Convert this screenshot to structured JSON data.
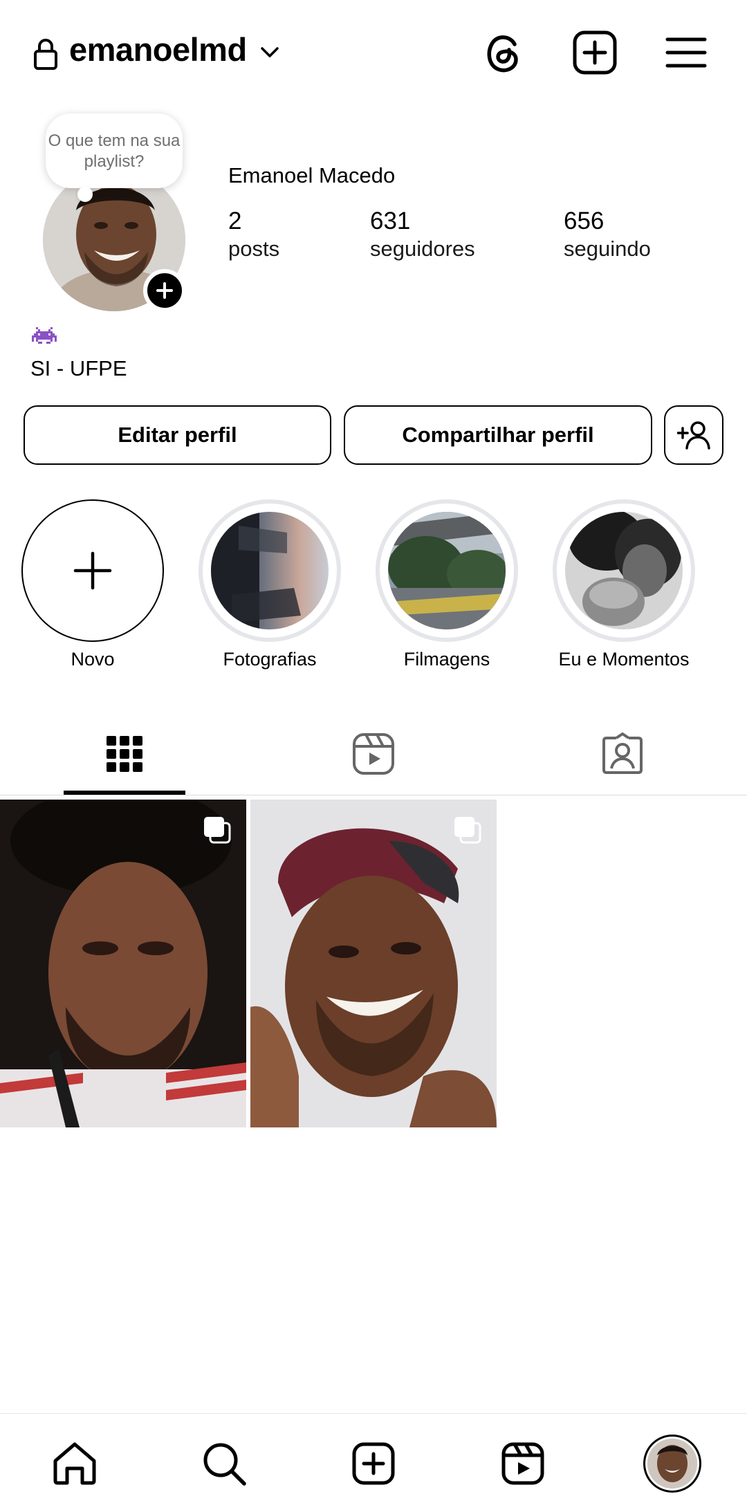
{
  "header": {
    "username": "emanoelmd",
    "icons": [
      "lock-icon",
      "chevron-down-icon",
      "threads-icon",
      "create-post-icon",
      "menu-icon"
    ]
  },
  "profile": {
    "note": "O que tem na sua playlist?",
    "full_name": "Emanoel Macedo",
    "stats": [
      {
        "value": "2",
        "label": "posts"
      },
      {
        "value": "631",
        "label": "seguidores"
      },
      {
        "value": "656",
        "label": "seguindo"
      }
    ],
    "bio_emoji": "alien-monster-emoji",
    "bio": "SI - UFPE"
  },
  "actions": {
    "edit_label": "Editar perfil",
    "share_label": "Compartilhar perfil"
  },
  "highlights": [
    {
      "label": "Novo"
    },
    {
      "label": "Fotografias"
    },
    {
      "label": "Filmagens"
    },
    {
      "label": "Eu e Momentos"
    }
  ],
  "tabs": [
    "grid-icon",
    "reels-icon",
    "tagged-icon"
  ],
  "active_tab": "grid",
  "bottom_nav": [
    "home-icon",
    "search-icon",
    "create-icon",
    "reels-icon",
    "profile-avatar"
  ]
}
